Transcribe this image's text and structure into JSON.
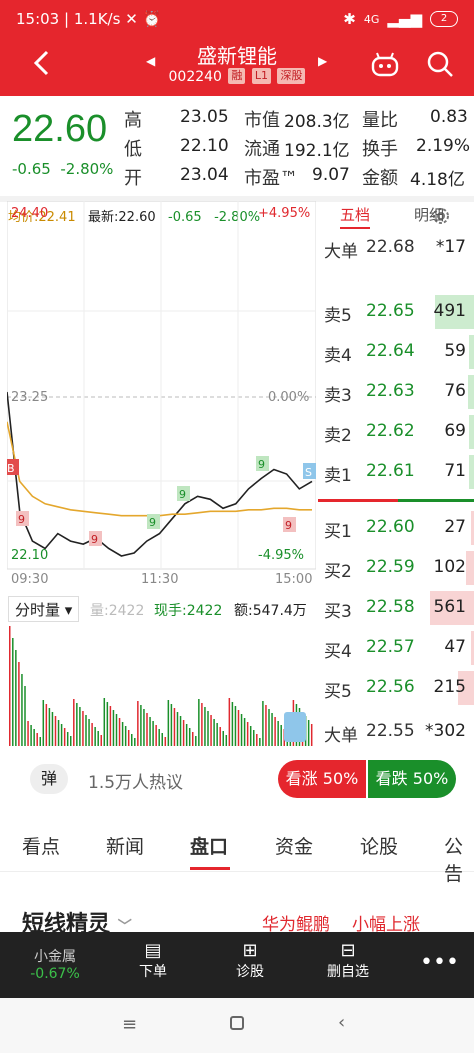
{
  "status": {
    "time": "15:03",
    "speed": "1.1K/s",
    "network": "4G",
    "battery": "2"
  },
  "header": {
    "title": "盛新锂能",
    "code": "002240",
    "tags": [
      "融",
      "L1",
      "深股"
    ]
  },
  "quote": {
    "price": "22.60",
    "change": "-0.65",
    "change_pct": "-2.80%",
    "high_label": "高",
    "high": "23.05",
    "low_label": "低",
    "low": "22.10",
    "open_label": "开",
    "open": "23.04",
    "mktcap_label": "市值",
    "mktcap": "208.3亿",
    "float_label": "流通",
    "float": "192.1亿",
    "pe_label": "市盈™",
    "pe": "9.07",
    "vr_label": "量比",
    "vr": "0.83",
    "turnover_label": "换手",
    "turnover": "2.19%",
    "amount_label": "金额",
    "amount": "4.18亿"
  },
  "chart_info": {
    "avg_label": "均价:22.41",
    "latest_label": "最新:22.60",
    "chg": "-0.65",
    "chg_pct": "-2.80%"
  },
  "chart_axes": {
    "top_price": "24.40",
    "top_pct": "+4.95%",
    "mid_price": "23.25",
    "mid_pct": "0.00%",
    "bot_price": "22.10",
    "bot_pct": "-4.95%",
    "t_open": "09:30",
    "t_mid": "11:30",
    "t_close": "15:00"
  },
  "volume_bar": {
    "selector": "分时量",
    "vol": "量:2422",
    "now": "现手:2422",
    "amt": "额:547.4万"
  },
  "chart_data": {
    "type": "line",
    "series": [
      {
        "values": [
          23.2,
          22.4,
          22.2,
          22.15,
          22.25,
          22.2,
          22.18,
          22.22,
          22.15,
          22.1,
          22.12,
          22.2,
          22.25,
          22.35,
          22.45,
          22.5,
          22.48,
          22.42,
          22.45,
          22.55,
          22.62,
          22.68,
          22.65,
          22.55,
          22.6
        ]
      },
      {
        "values": [
          23.0,
          22.6,
          22.5,
          22.45,
          22.43,
          22.41,
          22.4,
          22.39,
          22.38,
          22.37,
          22.37,
          22.37,
          22.37,
          22.38,
          22.38,
          22.39,
          22.4,
          22.4,
          22.4,
          22.41,
          22.41,
          22.42,
          22.42,
          22.41,
          22.41
        ]
      }
    ],
    "ylim": [
      22.1,
      24.4
    ]
  },
  "orderbook": {
    "tab_active": "五档",
    "tab_other": "明细",
    "big_sell": {
      "label": "大单",
      "price": "22.68",
      "vol": "*17"
    },
    "asks": [
      {
        "label": "卖5",
        "price": "22.65",
        "vol": "491",
        "fill": 0.25
      },
      {
        "label": "卖4",
        "price": "22.64",
        "vol": "59",
        "fill": 0.03
      },
      {
        "label": "卖3",
        "price": "22.63",
        "vol": "76",
        "fill": 0.04
      },
      {
        "label": "卖2",
        "price": "22.62",
        "vol": "69",
        "fill": 0.03
      },
      {
        "label": "卖1",
        "price": "22.61",
        "vol": "71",
        "fill": 0.03
      }
    ],
    "bids": [
      {
        "label": "买1",
        "price": "22.60",
        "vol": "27",
        "fill": 0.02
      },
      {
        "label": "买2",
        "price": "22.59",
        "vol": "102",
        "fill": 0.05
      },
      {
        "label": "买3",
        "price": "22.58",
        "vol": "561",
        "fill": 0.28
      },
      {
        "label": "买4",
        "price": "22.57",
        "vol": "47",
        "fill": 0.02
      },
      {
        "label": "买5",
        "price": "22.56",
        "vol": "215",
        "fill": 0.1
      }
    ],
    "big_buy": {
      "label": "大单",
      "price": "22.55",
      "vol": "*302"
    }
  },
  "heat": {
    "dan": "弹",
    "text": "1.5万人热议",
    "up": "看涨 50%",
    "down": "看跌 50%"
  },
  "tabs": [
    "看点",
    "新闻",
    "盘口",
    "资金",
    "论股",
    "公告"
  ],
  "news": {
    "title": "短线精灵",
    "t1": "华为鲲鹏",
    "t2": "小幅上涨"
  },
  "toolbar": {
    "metal": "小金属",
    "metal_chg": "-0.67%",
    "order": "下单",
    "diag": "诊股",
    "del": "删自选"
  },
  "colors": {
    "up": "#e0292f",
    "down": "#1a8f2a",
    "brand": "#e5262d"
  }
}
